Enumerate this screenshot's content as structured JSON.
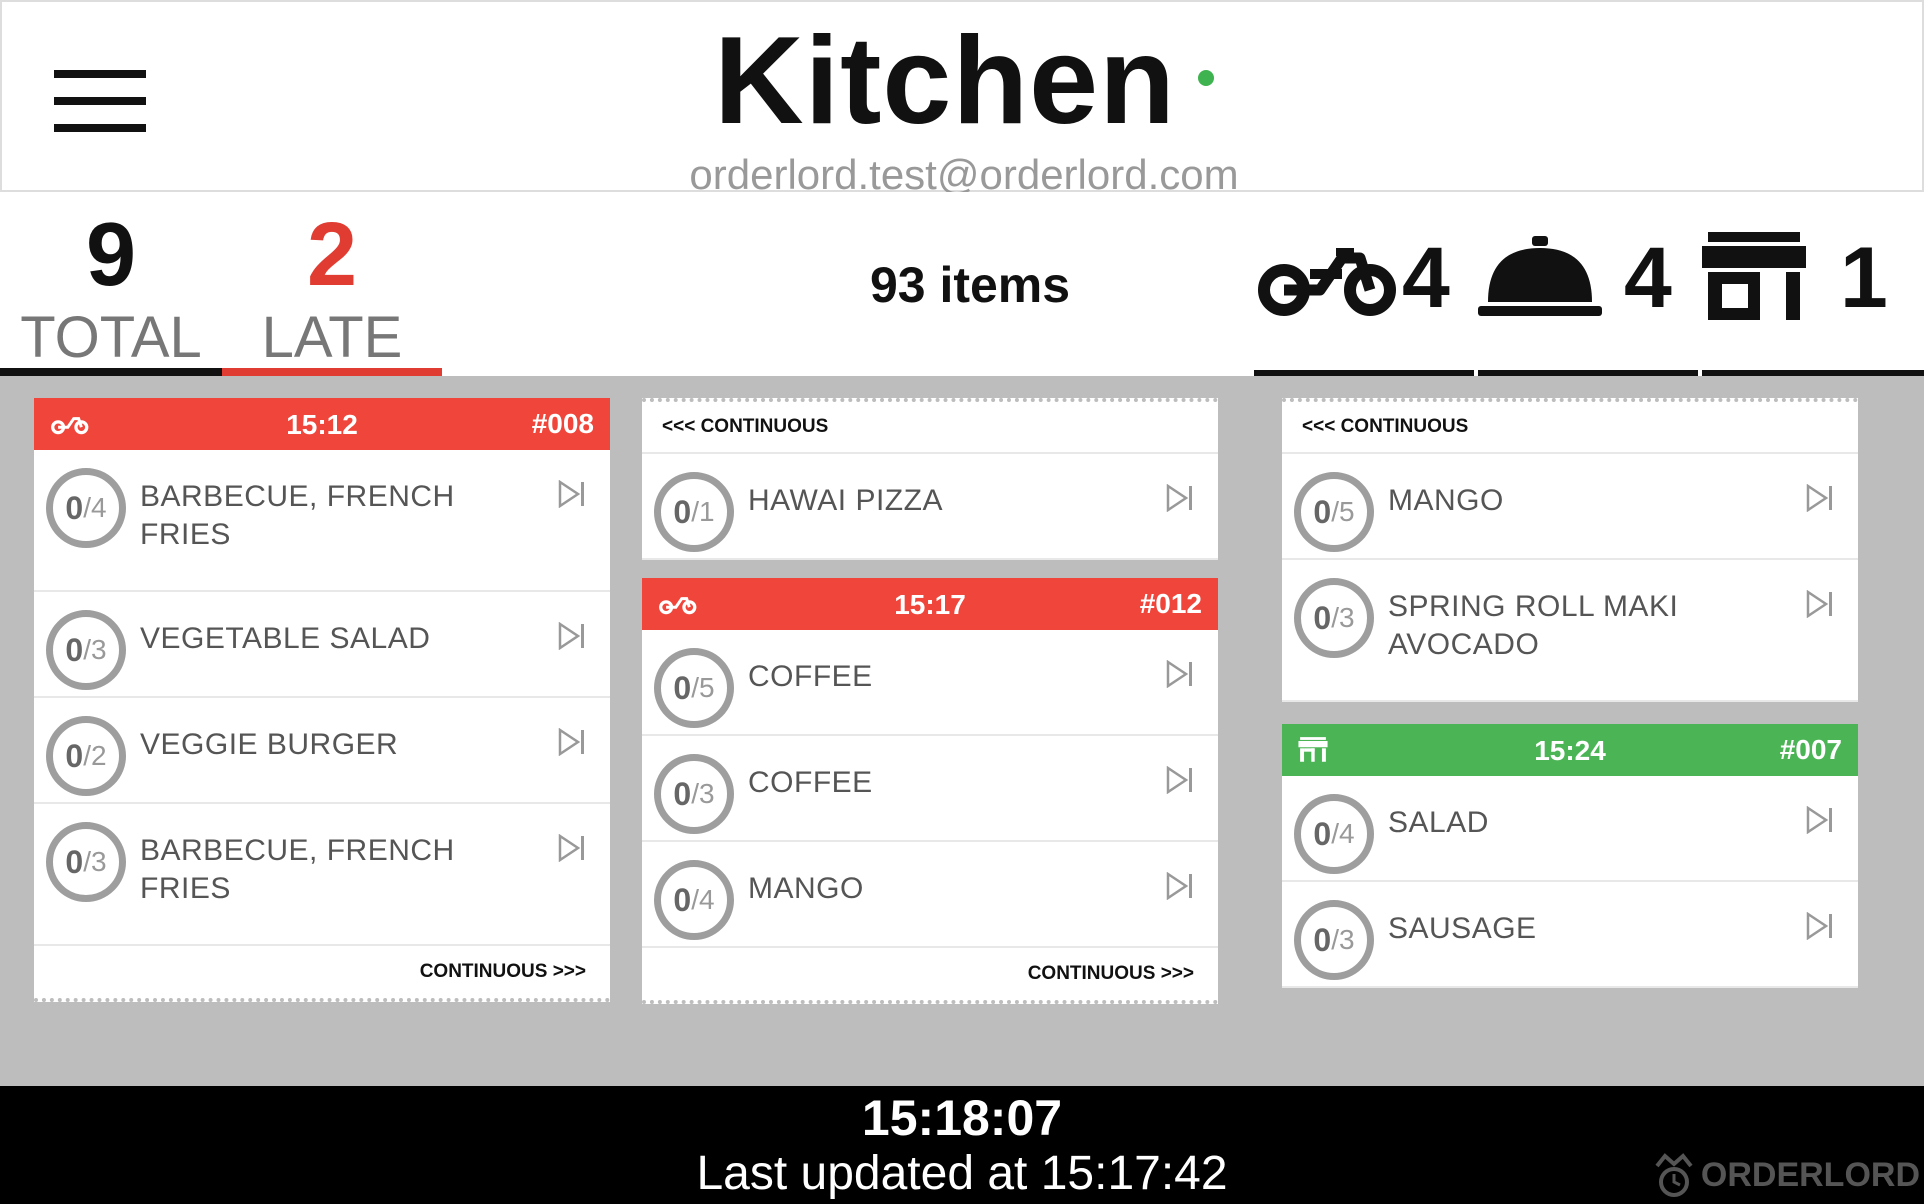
{
  "header": {
    "title": "Kitchen",
    "email": "orderlord.test@orderlord.com",
    "status_color": "#3fb34f"
  },
  "stats": {
    "total_value": "9",
    "total_label": "TOTAL",
    "late_value": "2",
    "late_label": "LATE",
    "items_text": "93 items",
    "delivery_count": "4",
    "dinein_count": "4",
    "takeaway_count": "1",
    "late_color": "#e03c31"
  },
  "columns": [
    {
      "tickets": [
        {
          "type_icon": "delivery-icon",
          "time": "15:12",
          "number": "#008",
          "head_color": "#f0453a",
          "items": [
            {
              "done": "0",
              "total": "4",
              "name": "BARBECUE, FRENCH FRIES"
            },
            {
              "done": "0",
              "total": "3",
              "name": "VEGETABLE SALAD"
            },
            {
              "done": "0",
              "total": "2",
              "name": "VEGGIE BURGER"
            },
            {
              "done": "0",
              "total": "3",
              "name": "BARBECUE, FRENCH FRIES"
            }
          ],
          "continuous_bottom": "CONTINUOUS >>>"
        }
      ]
    },
    {
      "tickets": [
        {
          "continuous_top": "<<< CONTINUOUS",
          "items": [
            {
              "done": "0",
              "total": "1",
              "name": "HAWAI PIZZA"
            }
          ]
        },
        {
          "type_icon": "delivery-icon",
          "time": "15:17",
          "number": "#012",
          "head_color": "#f0453a",
          "items": [
            {
              "done": "0",
              "total": "5",
              "name": "COFFEE"
            },
            {
              "done": "0",
              "total": "3",
              "name": "COFFEE"
            },
            {
              "done": "0",
              "total": "4",
              "name": "MANGO"
            }
          ],
          "continuous_bottom": "CONTINUOUS >>>"
        }
      ]
    },
    {
      "tickets": [
        {
          "continuous_top": "<<< CONTINUOUS",
          "items": [
            {
              "done": "0",
              "total": "5",
              "name": "MANGO"
            },
            {
              "done": "0",
              "total": "3",
              "name": "SPRING ROLL MAKI AVOCADO"
            }
          ]
        },
        {
          "type_icon": "takeaway-icon",
          "time": "15:24",
          "number": "#007",
          "head_color": "#4bb556",
          "items": [
            {
              "done": "0",
              "total": "4",
              "name": "SALAD"
            },
            {
              "done": "0",
              "total": "3",
              "name": "SAUSAGE"
            }
          ]
        }
      ]
    }
  ],
  "footer": {
    "clock": "15:18:07",
    "last_updated": "Last updated at 15:17:42",
    "brand": "ORDERLORD"
  }
}
